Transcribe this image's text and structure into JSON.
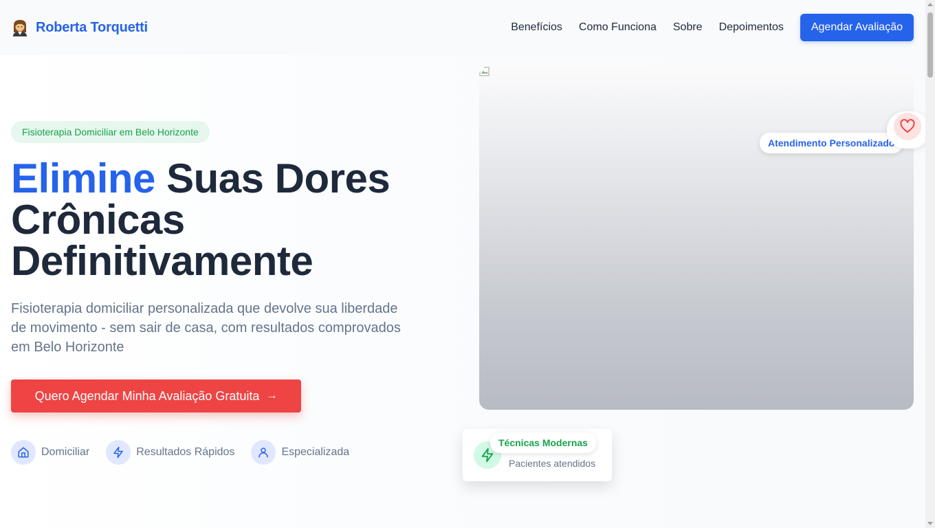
{
  "header": {
    "brand_name": "Roberta Torquetti",
    "brand_icon": "person-emoji-icon",
    "nav": [
      "Benefícios",
      "Como Funciona",
      "Sobre",
      "Depoimentos"
    ],
    "cta_label": "Agendar Avaliação"
  },
  "hero": {
    "badge": "Fisioterapia Domiciliar em Belo Horizonte",
    "headline_accent": "Elimine",
    "headline_rest_1": " Suas Dores",
    "headline_rest_2": "Crônicas",
    "headline_rest_3": "Definitivamente",
    "subtitle": "Fisioterapia domiciliar personalizada que devolve sua liberdade de movimento - sem sair de casa, com resultados comprovados em Belo Horizonte",
    "cta_label": "Quero Agendar Minha Avaliação Gratuita",
    "cta_arrow": "→",
    "features": [
      {
        "label": "Domiciliar",
        "icon": "home-icon"
      },
      {
        "label": "Resultados Rápidos",
        "icon": "lightning-icon"
      },
      {
        "label": "Especializada",
        "icon": "user-icon"
      }
    ]
  },
  "image_card": {
    "pill_top": "Atendimento Personalizado",
    "pill_bottom": "Técnicas Modernas",
    "stat_label": "Pacientes atendidos",
    "heart_icon": "heart-icon",
    "stat_icon": "lightning-icon"
  },
  "colors": {
    "primary": "#2563eb",
    "cta_red": "#ef4444",
    "badge_green": "#16a34a",
    "heading": "#1e293b",
    "muted": "#64748b"
  }
}
